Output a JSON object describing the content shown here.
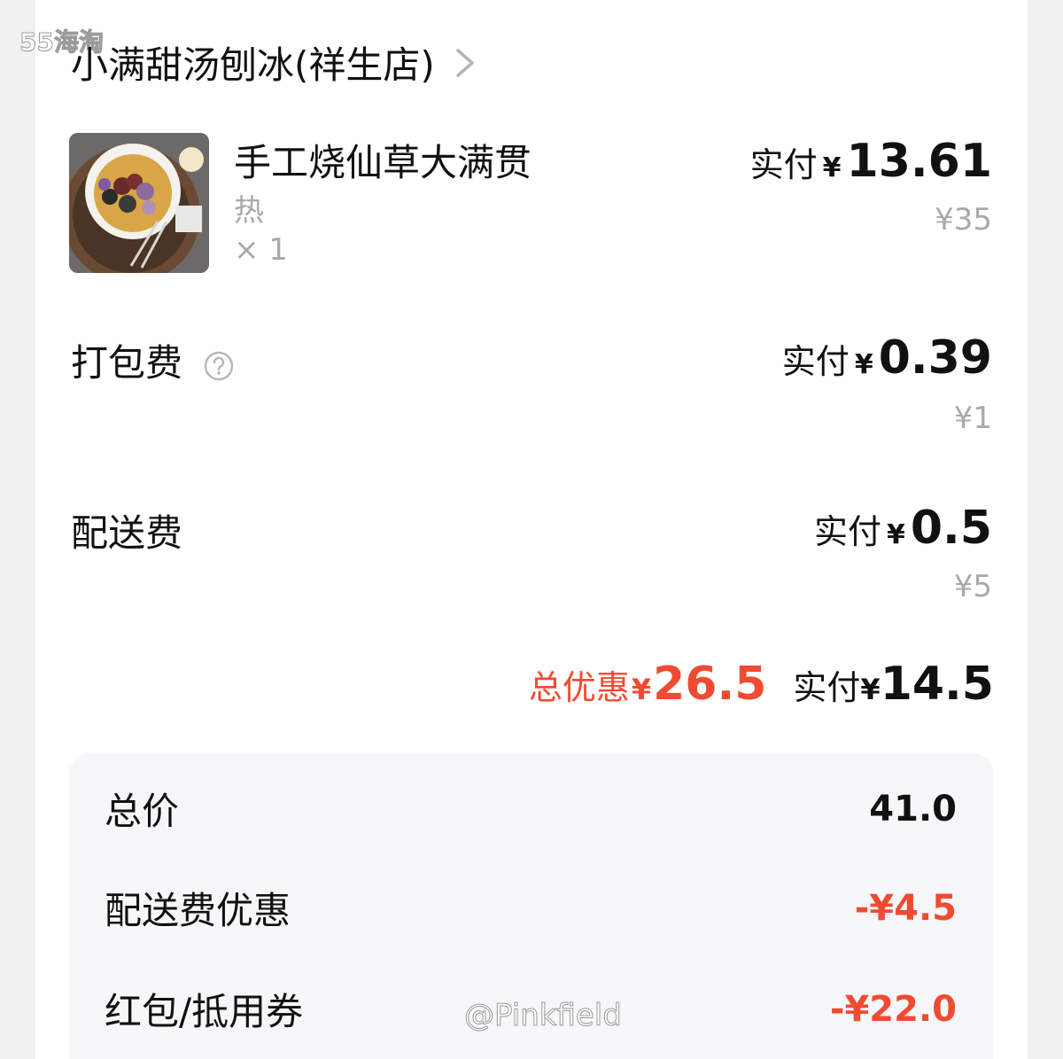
{
  "watermark": {
    "top_left": "55海淘",
    "bottom": "@Pinkfield"
  },
  "shop": {
    "name": "小满甜汤刨冰(祥生店)"
  },
  "item": {
    "name": "手工烧仙草大满贯",
    "spec": "热",
    "qty": "× 1",
    "pay_label": "实付",
    "currency": "¥",
    "paid": "13.61",
    "original": "¥35"
  },
  "packing": {
    "label": "打包费",
    "pay_label": "实付",
    "currency": "¥",
    "paid": "0.39",
    "original": "¥1"
  },
  "delivery": {
    "label": "配送费",
    "pay_label": "实付",
    "currency": "¥",
    "paid": "0.5",
    "original": "¥5"
  },
  "summary": {
    "discount_label": "总优惠",
    "discount_currency": "¥",
    "discount": "26.5",
    "total_label": "实付",
    "total_currency": "¥",
    "total": "14.5"
  },
  "breakdown": [
    {
      "label": "总价",
      "value": "41.0"
    },
    {
      "label": "配送费优惠",
      "value": "-¥4.5"
    },
    {
      "label": "红包/抵用券",
      "value": "-¥22.0"
    }
  ],
  "colors": {
    "accent_red": "#f04b32",
    "muted": "#a9a9a9",
    "panel": "#f6f7f9"
  }
}
